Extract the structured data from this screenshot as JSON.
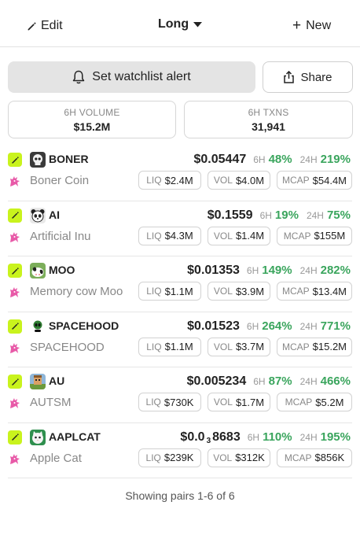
{
  "header": {
    "edit_label": "Edit",
    "sort_label": "Long",
    "new_label": "New"
  },
  "actions": {
    "alert_label": "Set watchlist alert",
    "share_label": "Share"
  },
  "stats": {
    "volume_label": "6H VOLUME",
    "volume_value": "$15.2M",
    "txns_label": "6H TXNS",
    "txns_value": "31,941"
  },
  "labels": {
    "h6": "6H",
    "h24": "24H",
    "liq": "LIQ",
    "vol": "VOL",
    "mcap": "MCAP"
  },
  "colors": {
    "positive": "#3aa55d",
    "badge": "#c9f31d",
    "unicorn": "#e85aa8"
  },
  "pairs": [
    {
      "symbol": "BONER",
      "name": "Boner Coin",
      "price": "$0.05447",
      "ch6h": "48%",
      "ch24h": "219%",
      "liq": "$2.4M",
      "vol": "$4.0M",
      "mcap": "$54.4M",
      "avatar": "skull-avatar"
    },
    {
      "symbol": "AI",
      "name": "Artificial Inu",
      "price": "$0.1559",
      "ch6h": "19%",
      "ch24h": "75%",
      "liq": "$4.3M",
      "vol": "$1.4M",
      "mcap": "$155M",
      "avatar": "panda-avatar"
    },
    {
      "symbol": "MOO",
      "name": "Memory cow Moo",
      "price": "$0.01353",
      "ch6h": "149%",
      "ch24h": "282%",
      "liq": "$1.1M",
      "vol": "$3.9M",
      "mcap": "$13.4M",
      "avatar": "cow-avatar"
    },
    {
      "symbol": "SPACEHOOD",
      "name": "SPACEHOOD",
      "price": "$0.01523",
      "ch6h": "264%",
      "ch24h": "771%",
      "liq": "$1.1M",
      "vol": "$3.7M",
      "mcap": "$15.2M",
      "avatar": "alien-avatar"
    },
    {
      "symbol": "AU",
      "name": "AUTSM",
      "price": "$0.005234",
      "ch6h": "87%",
      "ch24h": "466%",
      "liq": "$730K",
      "vol": "$1.7M",
      "mcap": "$5.2M",
      "avatar": "pixel-avatar"
    },
    {
      "symbol": "AAPLCAT",
      "name": "Apple Cat",
      "price_main": "$0.0",
      "price_sub": "3",
      "price_tail": "8683",
      "ch6h": "110%",
      "ch24h": "195%",
      "liq": "$239K",
      "vol": "$312K",
      "mcap": "$856K",
      "avatar": "cat-avatar"
    }
  ],
  "footer": {
    "text": "Showing pairs 1-6 of 6"
  }
}
